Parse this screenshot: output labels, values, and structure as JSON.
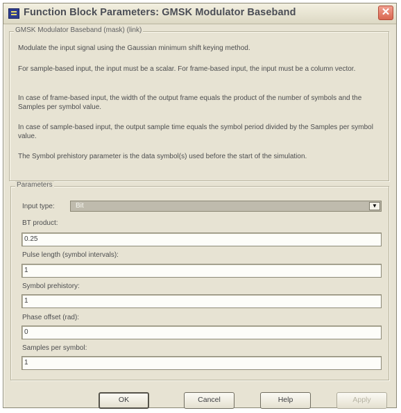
{
  "window": {
    "title": "Function Block Parameters: GMSK Modulator Baseband",
    "close_glyph": "✕"
  },
  "description_group": {
    "label": "GMSK Modulator Baseband (mask) (link)",
    "paragraphs": [
      "Modulate the input signal using the Gaussian minimum shift keying method.",
      "For sample-based input, the input must be a scalar. For frame-based input, the input must be a column vector.",
      "In case of frame-based input, the width of the output frame equals the product of the number of symbols and the Samples per symbol value.",
      "In case of sample-based input, the output sample time equals the symbol period divided by the Samples per symbol value.",
      "The Symbol prehistory parameter is the data symbol(s) used before the start of the simulation."
    ]
  },
  "parameters": {
    "label": "Parameters",
    "input_type": {
      "label": "Input type:",
      "value": "Bit",
      "arrow_glyph": "▼"
    },
    "fields": [
      {
        "label": "BT product:",
        "value": "0.25"
      },
      {
        "label": "Pulse length (symbol intervals):",
        "value": "1"
      },
      {
        "label": "Symbol prehistory:",
        "value": "1"
      },
      {
        "label": "Phase offset (rad):",
        "value": "0"
      },
      {
        "label": "Samples per symbol:",
        "value": "1"
      }
    ]
  },
  "buttons": {
    "ok": "OK",
    "cancel": "Cancel",
    "help": "Help",
    "apply": "Apply"
  },
  "colors": {
    "dialog_bg": "#e7e3d3",
    "title_text": "#4a4d55",
    "close_button": "#d96650",
    "select_bg": "#bfbbad"
  }
}
